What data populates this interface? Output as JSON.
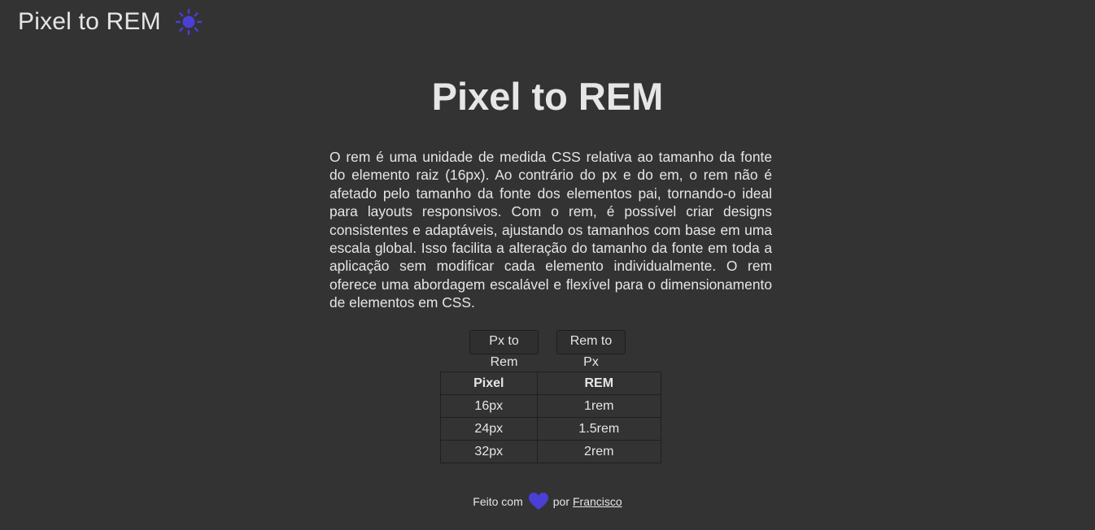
{
  "header": {
    "brand": "Pixel to REM",
    "theme_icon": "sun-icon"
  },
  "hero": {
    "title": "Pixel to REM",
    "intro": "O rem é uma unidade de medida CSS relativa ao tamanho da fonte do elemento raiz (16px). Ao contrário do px e do em, o rem não é afetado pelo tamanho da fonte dos elementos pai, tornando-o ideal para layouts responsivos. Com o rem, é possível criar designs consistentes e adaptáveis, ajustando os tamanhos com base em uma escala global. Isso facilita a alteração do tamanho da fonte em toda a aplicação sem modificar cada elemento individualmente. O rem oferece uma abordagem escalável e flexível para o dimensionamento de elementos em CSS."
  },
  "buttons": {
    "px_to_rem": "Px to Rem",
    "rem_to_px": "Rem to Px"
  },
  "table": {
    "headers": [
      "Pixel",
      "REM"
    ],
    "rows": [
      [
        "16px",
        "1rem"
      ],
      [
        "24px",
        "1.5rem"
      ],
      [
        "32px",
        "2rem"
      ]
    ]
  },
  "footer": {
    "made_with": "Feito com",
    "heart_icon": "heart-icon",
    "by": "por",
    "author": "Francisco"
  },
  "colors": {
    "background": "#333333",
    "text": "#e6e6e6",
    "accent": "#4b3fd6"
  }
}
